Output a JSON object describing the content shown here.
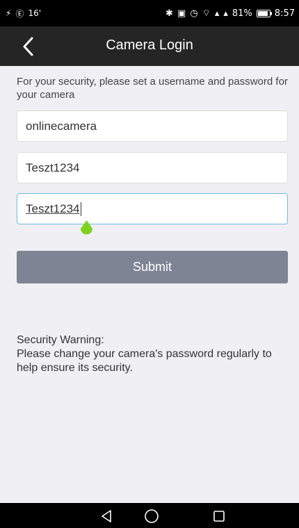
{
  "status_bar": {
    "left_icons": [
      "flash-icon",
      "circle-e-icon",
      "degree-icon"
    ],
    "small_text": "16'",
    "right_icons": [
      "bluetooth-icon",
      "nfc-icon",
      "alarm-icon",
      "wifi-icon",
      "signal-icon",
      "signal-icon"
    ],
    "battery": "81%",
    "time": "8:57"
  },
  "app_bar": {
    "title": "Camera Login",
    "back_icon": "chevron-left-icon"
  },
  "form": {
    "prompt": "For your security, please set a username and password for your camera",
    "username_value": "onlinecamera",
    "password_value": "Teszt1234",
    "confirm_password_value": "Teszt1234",
    "submit_label": "Submit"
  },
  "warning": {
    "title": "Security Warning:",
    "text": "Please change your camera's password regularly to help ensure its security."
  },
  "nav_bar": {
    "icons": [
      "back-triangle-icon",
      "home-circle-icon",
      "recents-square-icon"
    ]
  },
  "colors": {
    "app_bar": "#252525",
    "background": "#efeff4",
    "submit_button": "#7e8493",
    "focus_border": "#6bbde0",
    "text_handle": "#7ed321"
  }
}
